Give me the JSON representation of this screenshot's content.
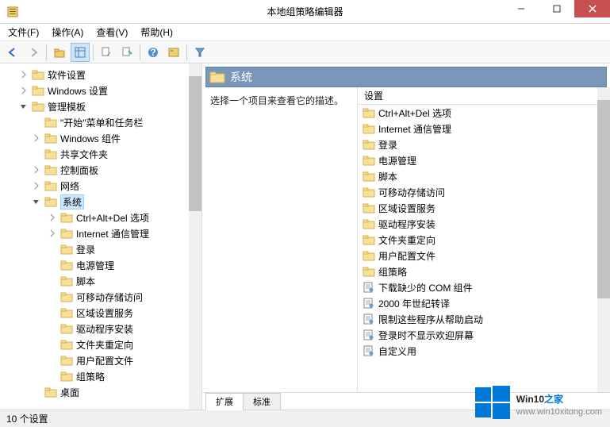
{
  "window": {
    "title": "本地组策略编辑器",
    "minimize": "–",
    "maximize": "☐",
    "close": "✕"
  },
  "menubar": {
    "file": "文件(F)",
    "action": "操作(A)",
    "view": "查看(V)",
    "help": "帮助(H)"
  },
  "toolbar_icons": [
    "back",
    "forward",
    "sep",
    "up",
    "list",
    "sep",
    "refresh",
    "export",
    "sep",
    "help",
    "view",
    "sep",
    "filter"
  ],
  "tree": [
    {
      "level": 1,
      "arrow": "closed",
      "label": "软件设置"
    },
    {
      "level": 1,
      "arrow": "closed",
      "label": "Windows 设置"
    },
    {
      "level": 1,
      "arrow": "open",
      "label": "管理模板"
    },
    {
      "level": 2,
      "arrow": "none",
      "label": "\"开始\"菜单和任务栏"
    },
    {
      "level": 2,
      "arrow": "closed",
      "label": "Windows 组件"
    },
    {
      "level": 2,
      "arrow": "none",
      "label": "共享文件夹"
    },
    {
      "level": 2,
      "arrow": "closed",
      "label": "控制面板"
    },
    {
      "level": 2,
      "arrow": "closed",
      "label": "网络"
    },
    {
      "level": 2,
      "arrow": "open",
      "label": "系统",
      "selected": true
    },
    {
      "level": 3,
      "arrow": "closed",
      "label": "Ctrl+Alt+Del 选项"
    },
    {
      "level": 3,
      "arrow": "closed",
      "label": "Internet 通信管理"
    },
    {
      "level": 3,
      "arrow": "none",
      "label": "登录"
    },
    {
      "level": 3,
      "arrow": "none",
      "label": "电源管理"
    },
    {
      "level": 3,
      "arrow": "none",
      "label": "脚本"
    },
    {
      "level": 3,
      "arrow": "none",
      "label": "可移动存储访问"
    },
    {
      "level": 3,
      "arrow": "none",
      "label": "区域设置服务"
    },
    {
      "level": 3,
      "arrow": "none",
      "label": "驱动程序安装"
    },
    {
      "level": 3,
      "arrow": "none",
      "label": "文件夹重定向"
    },
    {
      "level": 3,
      "arrow": "none",
      "label": "用户配置文件"
    },
    {
      "level": 3,
      "arrow": "none",
      "label": "组策略"
    },
    {
      "level": 2,
      "arrow": "none",
      "label": "桌面"
    }
  ],
  "details": {
    "header": "系统",
    "description": "选择一个项目来查看它的描述。",
    "column_header": "设置",
    "items": [
      {
        "type": "folder",
        "label": "Ctrl+Alt+Del 选项"
      },
      {
        "type": "folder",
        "label": "Internet 通信管理"
      },
      {
        "type": "folder",
        "label": "登录"
      },
      {
        "type": "folder",
        "label": "电源管理"
      },
      {
        "type": "folder",
        "label": "脚本"
      },
      {
        "type": "folder",
        "label": "可移动存储访问"
      },
      {
        "type": "folder",
        "label": "区域设置服务"
      },
      {
        "type": "folder",
        "label": "驱动程序安装"
      },
      {
        "type": "folder",
        "label": "文件夹重定向"
      },
      {
        "type": "folder",
        "label": "用户配置文件"
      },
      {
        "type": "folder",
        "label": "组策略"
      },
      {
        "type": "setting",
        "label": "下载缺少的 COM 组件"
      },
      {
        "type": "setting",
        "label": "2000 年世纪转译"
      },
      {
        "type": "setting",
        "label": "限制这些程序从帮助启动"
      },
      {
        "type": "setting",
        "label": "登录时不显示欢迎屏幕"
      },
      {
        "type": "setting",
        "label": "自定义用"
      }
    ]
  },
  "tabs": {
    "extended": "扩展",
    "standard": "标准"
  },
  "statusbar": {
    "count": "10 个设置"
  },
  "watermark": {
    "brand_main": "Win10",
    "brand_accent": "之家",
    "url": "www.win10xitong.com"
  }
}
